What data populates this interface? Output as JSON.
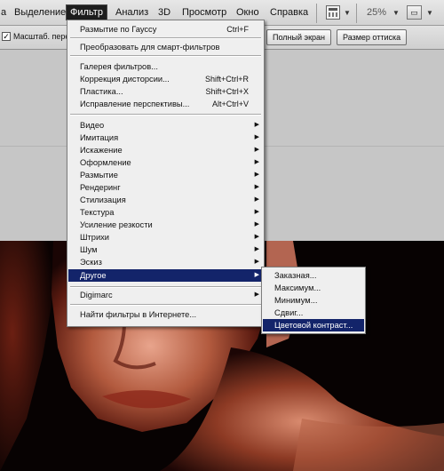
{
  "menubar": {
    "items": [
      "а",
      "Выделение",
      "Фильтр",
      "Анализ",
      "3D",
      "Просмотр",
      "Окно",
      "Справка"
    ],
    "active_index": 2,
    "zoom": "25%"
  },
  "options_bar": {
    "scale_label": "Масштаб. пере",
    "scale_checked": true,
    "buttons": [
      "Полный экран",
      "Размер оттиска"
    ]
  },
  "filter_menu": {
    "last_filter": {
      "label": "Размытие по Гауссу",
      "shortcut": "Ctrl+F"
    },
    "convert_smart": "Преобразовать для смарт-фильтров",
    "group1": [
      {
        "label": "Галерея фильтров...",
        "shortcut": ""
      },
      {
        "label": "Коррекция дисторсии...",
        "shortcut": "Shift+Ctrl+R"
      },
      {
        "label": "Пластика...",
        "shortcut": "Shift+Ctrl+X"
      },
      {
        "label": "Исправление перспективы...",
        "shortcut": "Alt+Ctrl+V"
      }
    ],
    "submenus": [
      "Видео",
      "Имитация",
      "Искажение",
      "Оформление",
      "Размытие",
      "Рендеринг",
      "Стилизация",
      "Текстура",
      "Усиление резкости",
      "Штрихи",
      "Шум",
      "Эскиз",
      "Другое"
    ],
    "highlighted_submenu": "Другое",
    "digimarc": "Digimarc",
    "browse_online": "Найти фильтры в Интернете..."
  },
  "other_submenu": {
    "items": [
      "Заказная...",
      "Максимум...",
      "Минимум...",
      "Сдвиг...",
      "Цветовой контраст..."
    ],
    "highlighted_index": 4
  },
  "colors": {
    "menu_highlight": "#13246a",
    "menu_bg": "#efefef",
    "active_menu_bg": "#1d1d1d"
  }
}
